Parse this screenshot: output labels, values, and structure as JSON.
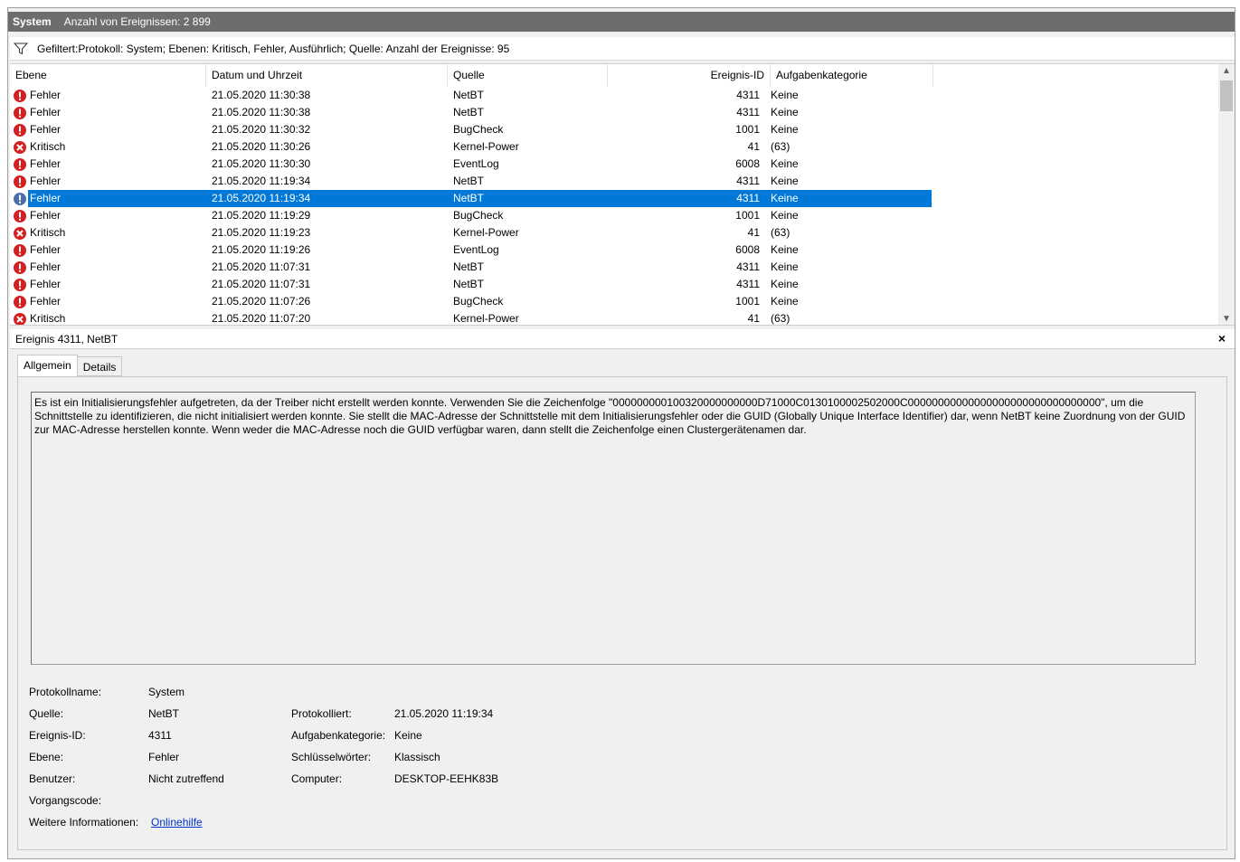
{
  "title": {
    "name": "System",
    "count": "Anzahl von Ereignissen: 2 899"
  },
  "filter": {
    "text": "Gefiltert:Protokoll: System; Ebenen: Kritisch, Fehler, Ausführlich; Quelle:  Anzahl der Ereignisse: 95"
  },
  "columns": {
    "level": "Ebene",
    "date": "Datum und Uhrzeit",
    "source": "Quelle",
    "id": "Ereignis-ID",
    "category": "Aufgabenkategorie"
  },
  "events": [
    {
      "kind": "error",
      "level": "Fehler",
      "date": "21.05.2020 11:30:38",
      "source": "NetBT",
      "id": "4311",
      "category": "Keine"
    },
    {
      "kind": "error",
      "level": "Fehler",
      "date": "21.05.2020 11:30:38",
      "source": "NetBT",
      "id": "4311",
      "category": "Keine"
    },
    {
      "kind": "error",
      "level": "Fehler",
      "date": "21.05.2020 11:30:32",
      "source": "BugCheck",
      "id": "1001",
      "category": "Keine"
    },
    {
      "kind": "critical",
      "level": "Kritisch",
      "date": "21.05.2020 11:30:26",
      "source": "Kernel-Power",
      "id": "41",
      "category": "(63)"
    },
    {
      "kind": "error",
      "level": "Fehler",
      "date": "21.05.2020 11:30:30",
      "source": "EventLog",
      "id": "6008",
      "category": "Keine"
    },
    {
      "kind": "error",
      "level": "Fehler",
      "date": "21.05.2020 11:19:34",
      "source": "NetBT",
      "id": "4311",
      "category": "Keine"
    },
    {
      "kind": "error",
      "level": "Fehler",
      "date": "21.05.2020 11:19:34",
      "source": "NetBT",
      "id": "4311",
      "category": "Keine",
      "selected": true
    },
    {
      "kind": "error",
      "level": "Fehler",
      "date": "21.05.2020 11:19:29",
      "source": "BugCheck",
      "id": "1001",
      "category": "Keine"
    },
    {
      "kind": "critical",
      "level": "Kritisch",
      "date": "21.05.2020 11:19:23",
      "source": "Kernel-Power",
      "id": "41",
      "category": "(63)"
    },
    {
      "kind": "error",
      "level": "Fehler",
      "date": "21.05.2020 11:19:26",
      "source": "EventLog",
      "id": "6008",
      "category": "Keine"
    },
    {
      "kind": "error",
      "level": "Fehler",
      "date": "21.05.2020 11:07:31",
      "source": "NetBT",
      "id": "4311",
      "category": "Keine"
    },
    {
      "kind": "error",
      "level": "Fehler",
      "date": "21.05.2020 11:07:31",
      "source": "NetBT",
      "id": "4311",
      "category": "Keine"
    },
    {
      "kind": "error",
      "level": "Fehler",
      "date": "21.05.2020 11:07:26",
      "source": "BugCheck",
      "id": "1001",
      "category": "Keine"
    },
    {
      "kind": "critical",
      "level": "Kritisch",
      "date": "21.05.2020 11:07:20",
      "source": "Kernel-Power",
      "id": "41",
      "category": "(63)"
    }
  ],
  "detail": {
    "header": "Ereignis 4311, NetBT",
    "close": "×",
    "tabs": [
      "Allgemein",
      "Details"
    ],
    "description": "Es ist ein Initialisierungsfehler aufgetreten, da der Treiber nicht erstellt werden konnte. Verwenden Sie die Zeichenfolge \"000000000100320000000000D71000C0130100002502000C00000000000000000000000000000000\", um die Schnittstelle zu identifizieren, die nicht initialisiert werden konnte. Sie stellt die MAC-Adresse der Schnittstelle mit dem Initialisierungsfehler oder die  GUID (Globally Unique Interface Identifier) dar, wenn NetBT keine Zuordnung  von der GUID zur MAC-Adresse herstellen konnte. Wenn weder die MAC-Adresse noch die GUID verfügbar  waren, dann stellt die Zeichenfolge einen Clustergerätenamen dar.",
    "props": {
      "logname_label": "Protokollname:",
      "logname": "System",
      "source_label": "Quelle:",
      "source": "NetBT",
      "logged_label": "Protokolliert:",
      "logged": "21.05.2020 11:19:34",
      "eventid_label": "Ereignis-ID:",
      "eventid": "4311",
      "taskcat_label": "Aufgabenkategorie:",
      "taskcat": "Keine",
      "level_label": "Ebene:",
      "level": "Fehler",
      "keywords_label": "Schlüsselwörter:",
      "keywords": "Klassisch",
      "user_label": "Benutzer:",
      "user": "Nicht zutreffend",
      "computer_label": "Computer:",
      "computer": "DESKTOP-EEHK83B",
      "opcode_label": "Vorgangscode:",
      "moreinfo_label": "Weitere Informationen:",
      "moreinfo_link": "Onlinehilfe"
    }
  },
  "colors": {
    "accent": "#0078d7",
    "error": "#d42020",
    "titlebar": "#6d6d6d"
  }
}
